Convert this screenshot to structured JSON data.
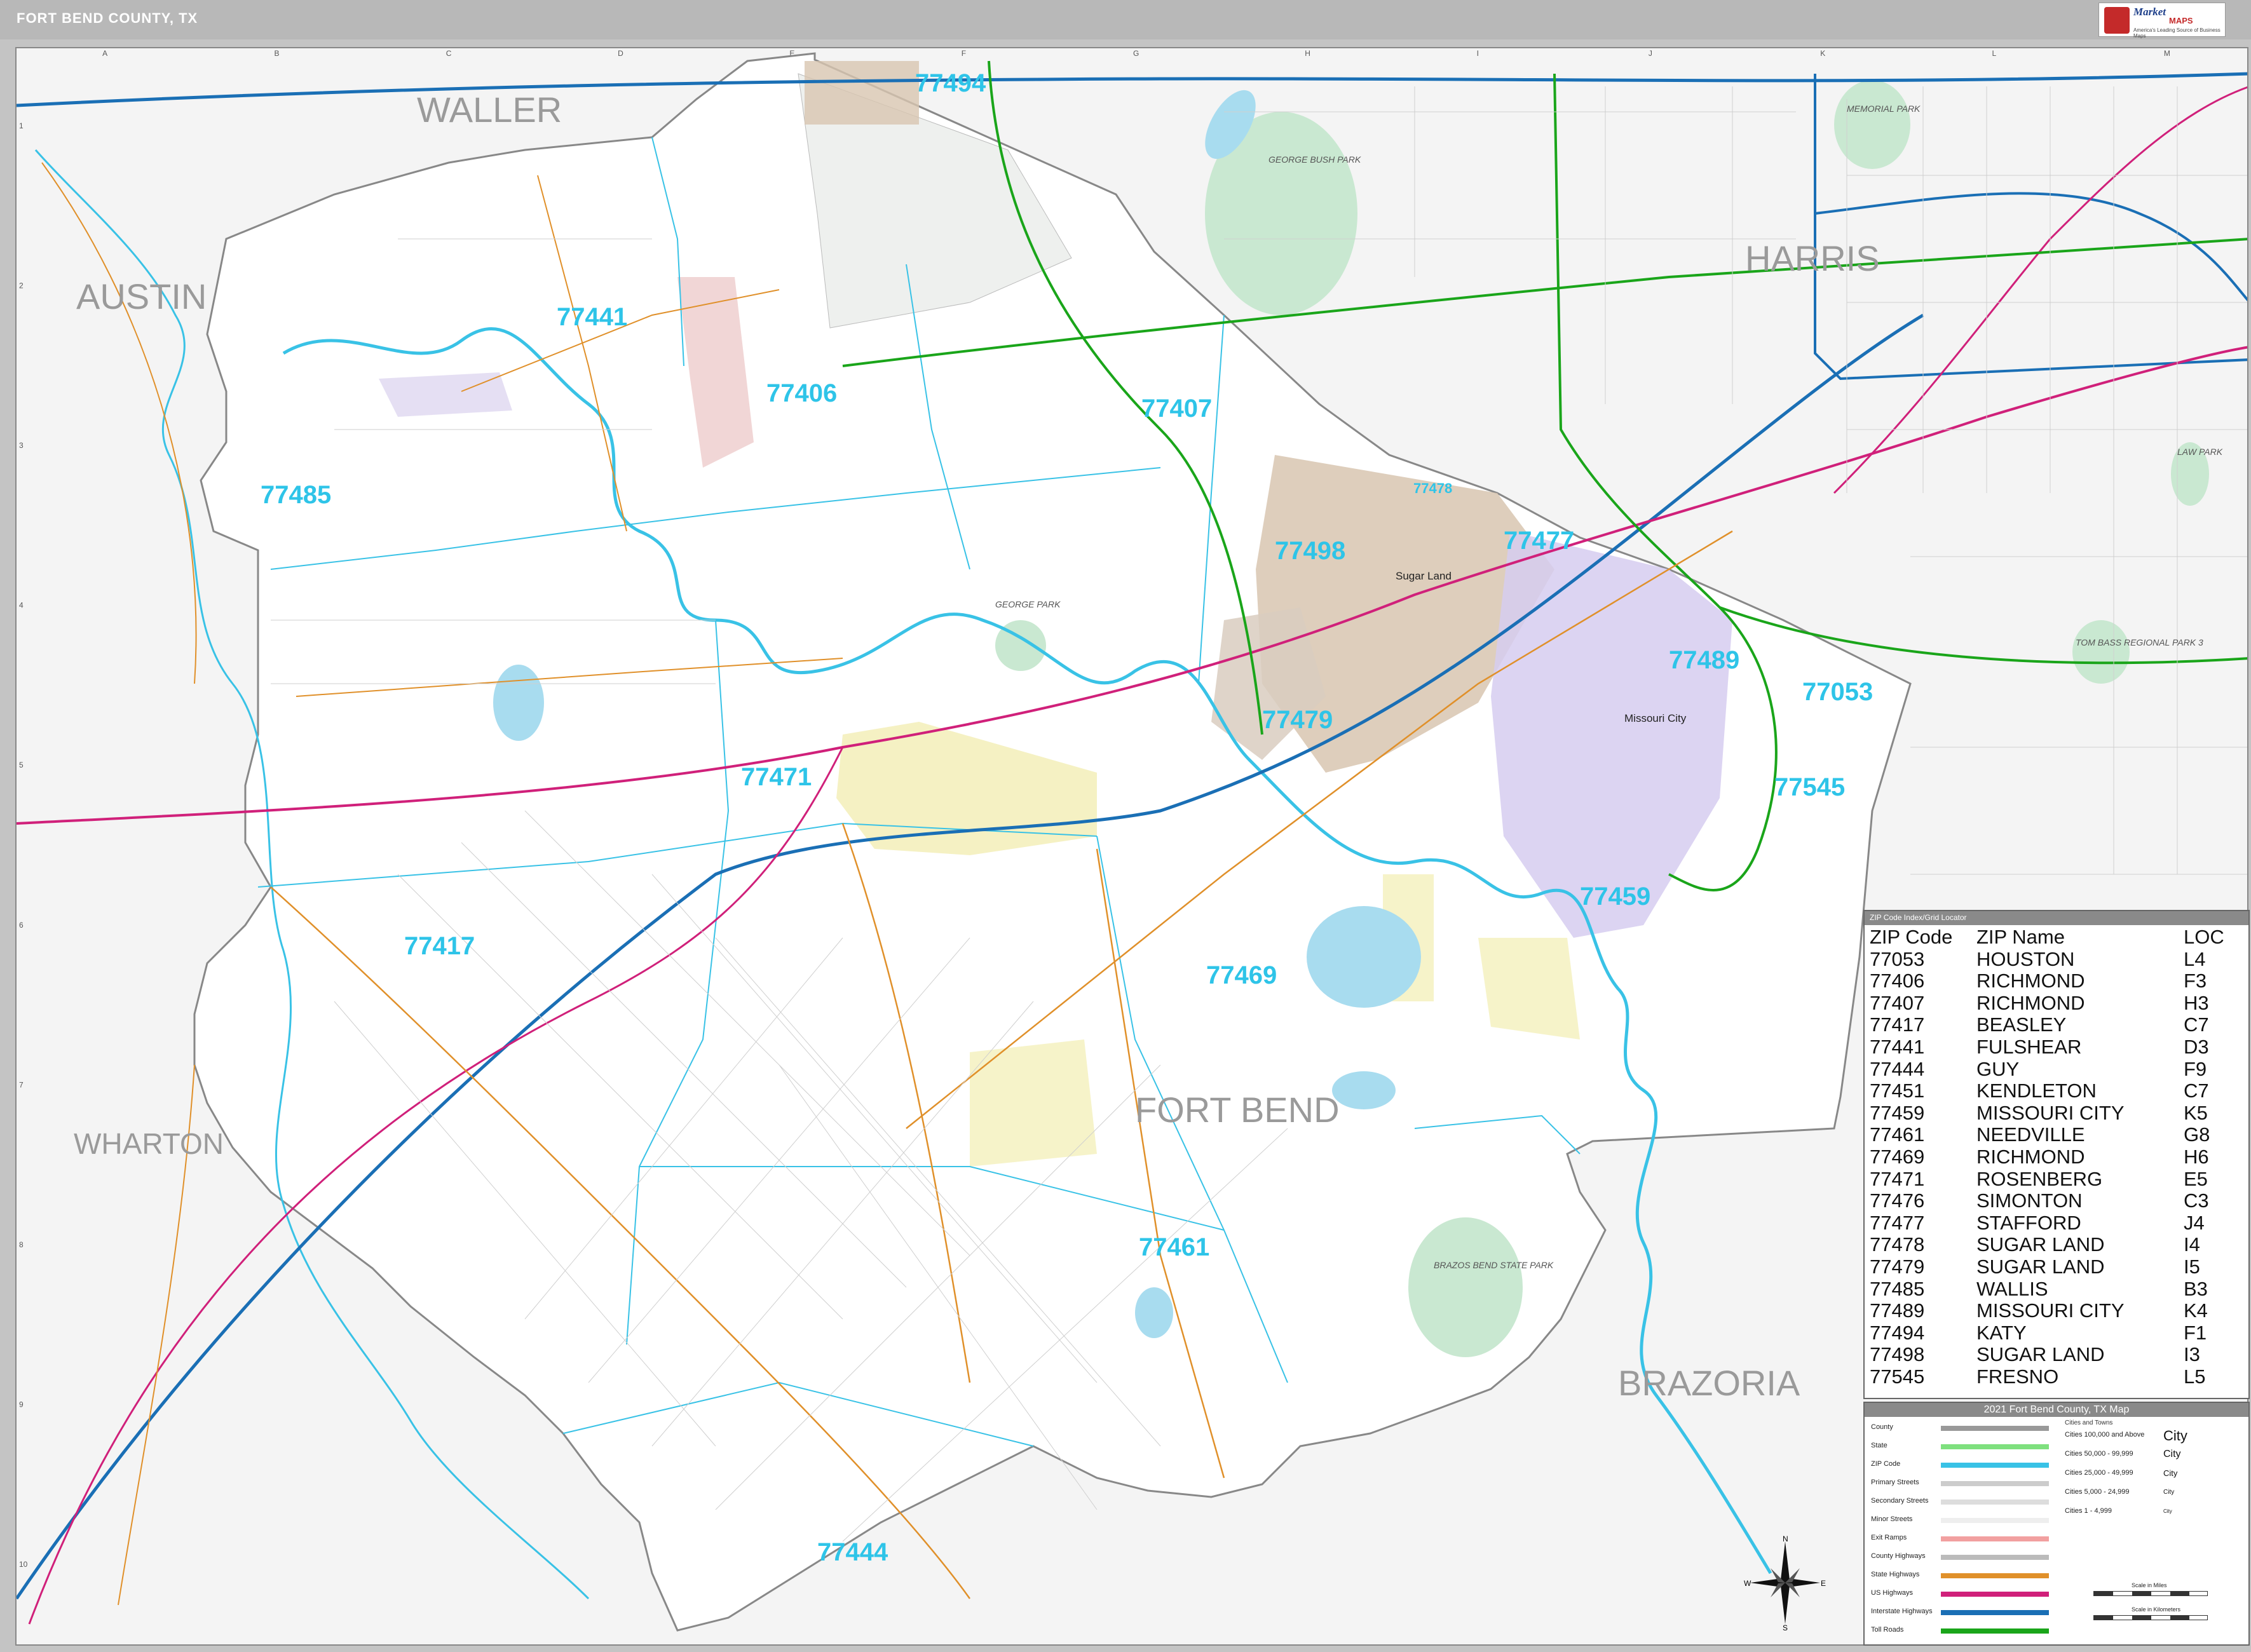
{
  "header": {
    "title": "FORT BEND COUNTY, TX",
    "brand_name": "Market",
    "brand_maps": "MAPS",
    "brand_tagline": "America's Leading Source of Business Maps"
  },
  "map": {
    "grid_columns": [
      "A",
      "B",
      "C",
      "D",
      "E",
      "F",
      "G",
      "H",
      "I",
      "J",
      "K",
      "L",
      "M"
    ],
    "grid_rows": [
      "1",
      "2",
      "3",
      "4",
      "5",
      "6",
      "7",
      "8",
      "9",
      "10"
    ],
    "counties": [
      "WALLER",
      "AUSTIN",
      "HARRIS",
      "WHARTON",
      "FORT BEND",
      "BRAZORIA"
    ],
    "zip_labels": [
      "77494",
      "77441",
      "77406",
      "77407",
      "77485",
      "77478",
      "77498",
      "77477",
      "77489",
      "77053",
      "77479",
      "77471",
      "77545",
      "77459",
      "77417",
      "77469",
      "77461",
      "77444"
    ],
    "cities": [
      "Sugar Land",
      "Missouri City"
    ],
    "parks": [
      "GEORGE BUSH PARK",
      "MEMORIAL PARK",
      "GEORGE PARK",
      "BRAZOS BEND STATE PARK",
      "LAW PARK",
      "TOM BASS REGIONAL PARK 3"
    ],
    "colors": {
      "water": "#39c2e6",
      "lake": "#a8dcef",
      "zip_label": "#2ec4e8",
      "interstate": "#1a6fb5",
      "toll": "#1aa51a",
      "us_highway": "#d0207a",
      "state_highway": "#e0902a",
      "county_line": "#999999",
      "park": "#c9e8d1"
    }
  },
  "zip_index": {
    "header": "ZIP Code Index/Grid Locator",
    "columns": [
      "ZIP Code",
      "ZIP Name",
      "LOC"
    ],
    "rows": [
      [
        "77053",
        "HOUSTON",
        "L4"
      ],
      [
        "77406",
        "RICHMOND",
        "F3"
      ],
      [
        "77407",
        "RICHMOND",
        "H3"
      ],
      [
        "77417",
        "BEASLEY",
        "C7"
      ],
      [
        "77441",
        "FULSHEAR",
        "D3"
      ],
      [
        "77444",
        "GUY",
        "F9"
      ],
      [
        "77451",
        "KENDLETON",
        "C7"
      ],
      [
        "77459",
        "MISSOURI CITY",
        "K5"
      ],
      [
        "77461",
        "NEEDVILLE",
        "G8"
      ],
      [
        "77469",
        "RICHMOND",
        "H6"
      ],
      [
        "77471",
        "ROSENBERG",
        "E5"
      ],
      [
        "77476",
        "SIMONTON",
        "C3"
      ],
      [
        "77477",
        "STAFFORD",
        "J4"
      ],
      [
        "77478",
        "SUGAR LAND",
        "I4"
      ],
      [
        "77479",
        "SUGAR LAND",
        "I5"
      ],
      [
        "77485",
        "WALLIS",
        "B3"
      ],
      [
        "77489",
        "MISSOURI CITY",
        "K4"
      ],
      [
        "77494",
        "KATY",
        "F1"
      ],
      [
        "77498",
        "SUGAR LAND",
        "I3"
      ],
      [
        "77545",
        "FRESNO",
        "L5"
      ]
    ]
  },
  "legend": {
    "title": "2021 Fort Bend County, TX Map",
    "subtitle": "Cities and Towns",
    "items": [
      {
        "label": "County",
        "color": "#999999"
      },
      {
        "label": "State",
        "color": "#7ee07e"
      },
      {
        "label": "ZIP Code",
        "color": "#39c2e6"
      },
      {
        "label": "Primary Streets",
        "color": "#cccccc"
      },
      {
        "label": "Secondary Streets",
        "color": "#dddddd"
      },
      {
        "label": "Minor Streets",
        "color": "#eeeeee"
      },
      {
        "label": "Exit Ramps",
        "color": "#f2a0a0"
      },
      {
        "label": "County Highways",
        "color": "#bbbbbb"
      },
      {
        "label": "State Highways",
        "color": "#e0902a"
      },
      {
        "label": "US Highways",
        "color": "#d0207a"
      },
      {
        "label": "Interstate Highways",
        "color": "#1a6fb5"
      },
      {
        "label": "Toll Roads",
        "color": "#1aa51a"
      }
    ],
    "city_sizes": [
      {
        "label": "Cities 100,000 and Above",
        "sym": "City"
      },
      {
        "label": "Cities 50,000 - 99,999",
        "sym": "City"
      },
      {
        "label": "Cities 25,000 - 49,999",
        "sym": "City"
      },
      {
        "label": "Cities 5,000 - 24,999",
        "sym": "City"
      },
      {
        "label": "Cities 1 - 4,999",
        "sym": "City"
      }
    ],
    "scale_miles": "Scale in Miles",
    "scale_km": "Scale in Kilometers"
  },
  "compass": {
    "n": "N",
    "s": "S",
    "e": "E",
    "w": "W"
  }
}
